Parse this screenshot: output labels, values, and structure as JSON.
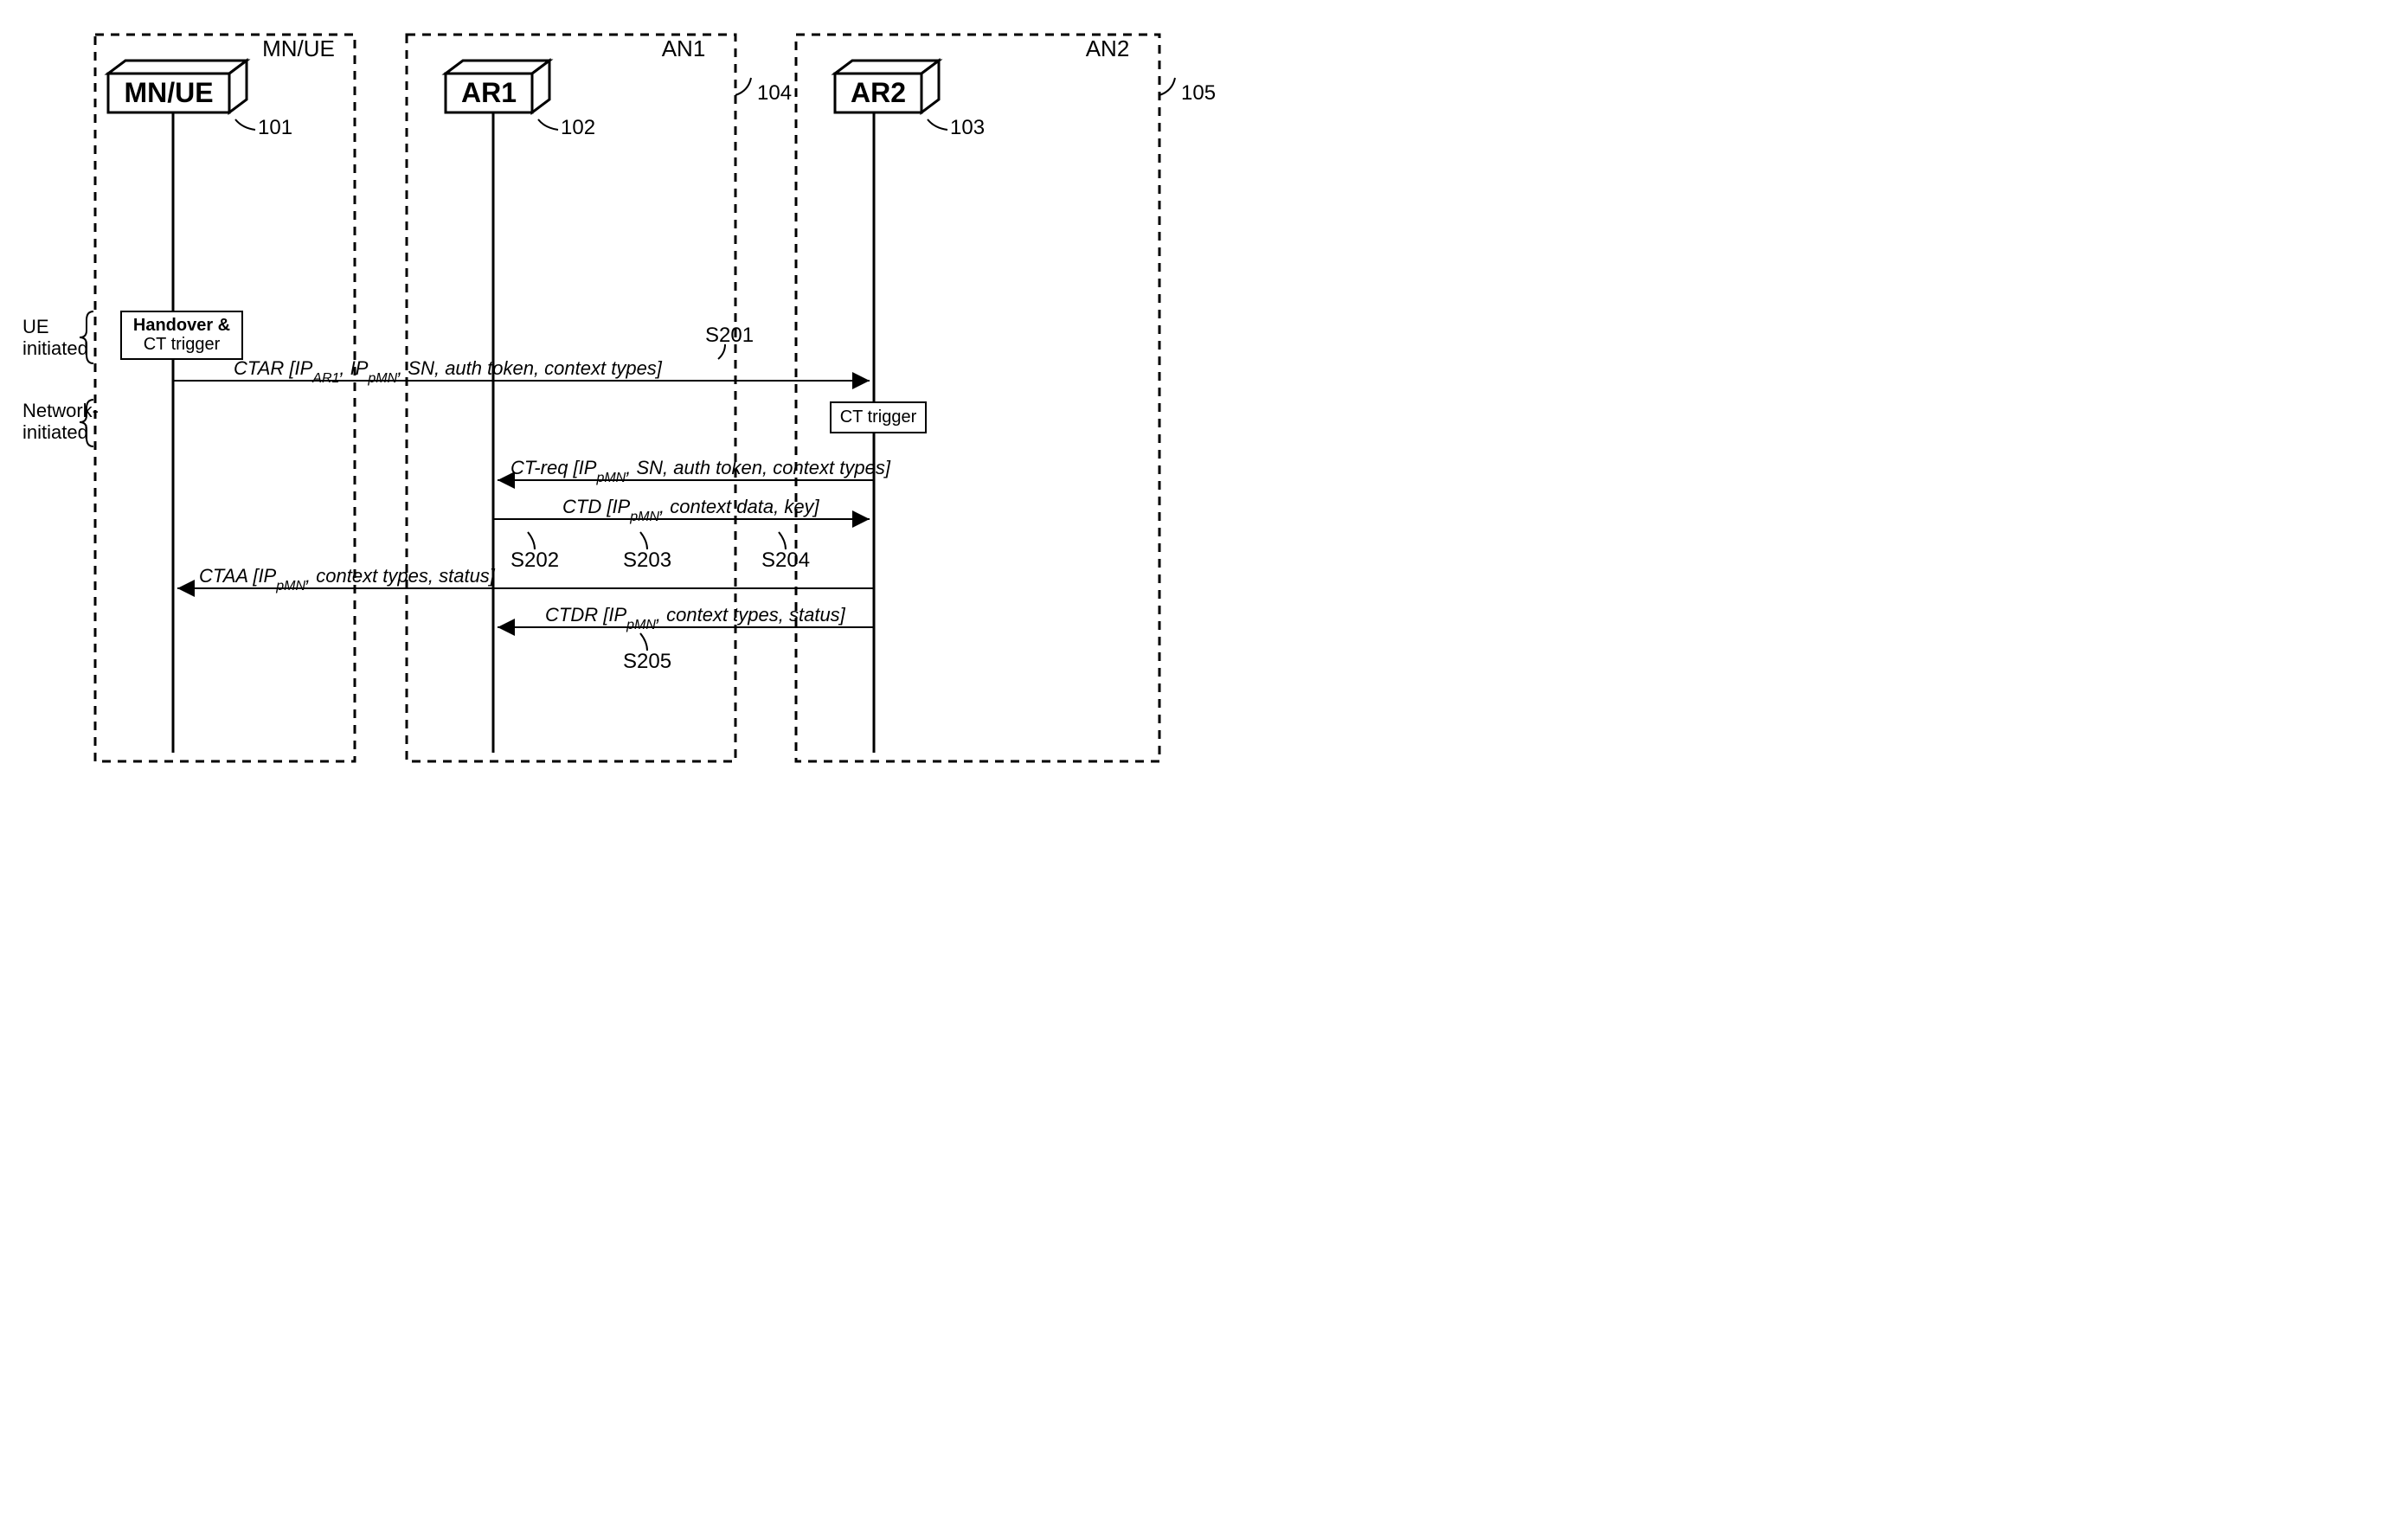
{
  "containers": {
    "mn": {
      "label": "MN/UE"
    },
    "an1": {
      "label": "AN1",
      "ref": "104"
    },
    "an2": {
      "label": "AN2",
      "ref": "105"
    }
  },
  "actors": {
    "mn": {
      "label": "MN/UE",
      "ref": "101"
    },
    "ar1": {
      "label": "AR1",
      "ref": "102"
    },
    "ar2": {
      "label": "AR2",
      "ref": "103"
    }
  },
  "side_labels": {
    "ue": "UE\ninitiated",
    "net": "Network-\ninitiated"
  },
  "triggers": {
    "handover": {
      "l1": "Handover &",
      "l2": "CT trigger"
    },
    "ct": "CT trigger"
  },
  "messages": {
    "ctar": {
      "prefix": "CTAR [IP",
      "sub1": "AR1",
      "mid": ", IP",
      "sub2": "pMN",
      "rest": ", SN, auth token, context types]"
    },
    "ctreq": {
      "prefix": "CT-req [IP",
      "sub1": "pMN",
      "rest": ", SN, auth token, context types]"
    },
    "ctd": {
      "prefix": "CTD [IP",
      "sub1": "pMN",
      "rest": ", context data, key]"
    },
    "ctaa": {
      "prefix": "CTAA [IP",
      "sub1": "pMN",
      "rest": ", context types, status]"
    },
    "ctdr": {
      "prefix": "CTDR [IP",
      "sub1": "pMN",
      "rest": ", context types, status]"
    }
  },
  "steps": {
    "s201": "S201",
    "s202": "S202",
    "s203": "S203",
    "s204": "S204",
    "s205": "S205"
  }
}
